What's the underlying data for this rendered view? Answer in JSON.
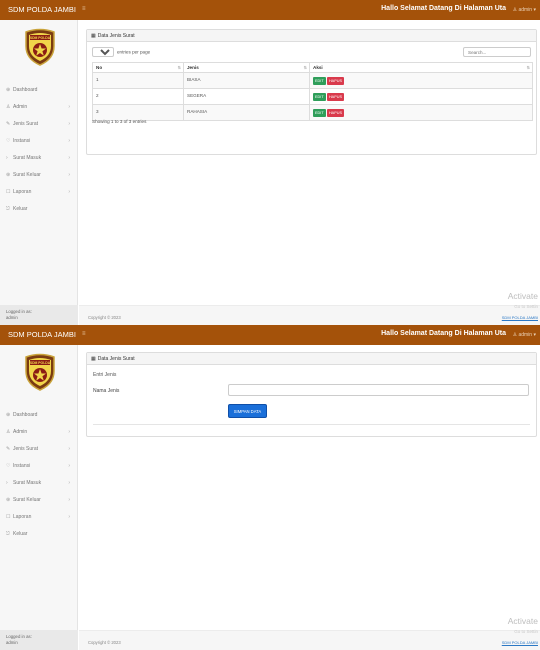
{
  "app": {
    "brand": "SDM POLDA JAMBI",
    "welcome": "Hallo Selamat Datang Di Halaman Uta",
    "user_label": "admin",
    "logo_text": "SDM POLDA"
  },
  "sidebar": {
    "items": [
      {
        "label": "Dashboard",
        "icon": "⊕",
        "has_arrow": false
      },
      {
        "label": "Admin",
        "icon": "♙",
        "has_arrow": true
      },
      {
        "label": "Jenis Surat",
        "icon": "✎",
        "has_arrow": true
      },
      {
        "label": "Instansi",
        "icon": "♡",
        "has_arrow": true
      },
      {
        "label": "Surat Masuk",
        "icon": "›",
        "has_arrow": true
      },
      {
        "label": "Surat Keluar",
        "icon": "⊛",
        "has_arrow": true
      },
      {
        "label": "Laporan",
        "icon": "☐",
        "has_arrow": true
      },
      {
        "label": "Keluar",
        "icon": "⎋",
        "has_arrow": false
      }
    ],
    "logged_in_line1": "Logged in as:",
    "logged_in_line2": "admin"
  },
  "footer": {
    "copyright": "Copyright © 2023",
    "link": "SDM POLDA JAMBI",
    "activate": "Activate",
    "goto": "Go to Settin"
  },
  "list_view": {
    "panel_title": "Data Jenis Surat",
    "entries_value": "10",
    "entries_label": "entries per page",
    "search_placeholder": "Search...",
    "columns": [
      "No",
      "Jenis",
      "Aksi"
    ],
    "rows": [
      {
        "no": "1",
        "jenis": "BIASA"
      },
      {
        "no": "2",
        "jenis": "SEGERA"
      },
      {
        "no": "3",
        "jenis": "RAHASIA"
      }
    ],
    "edit_label": "EDIT",
    "delete_label": "HAPUS",
    "showing": "Showing 1 to 3 of 3 entries"
  },
  "form_view": {
    "panel_title": "Data Jenis Surat",
    "form_title": "Entri Jenis",
    "field_label": "Nama Jenis",
    "field_value": "",
    "save_label": "SIMPAN DATA"
  },
  "colors": {
    "topbar": "#a4520a",
    "edit": "#2f9e5a",
    "delete": "#d93a4c",
    "save": "#1a6fd9"
  }
}
